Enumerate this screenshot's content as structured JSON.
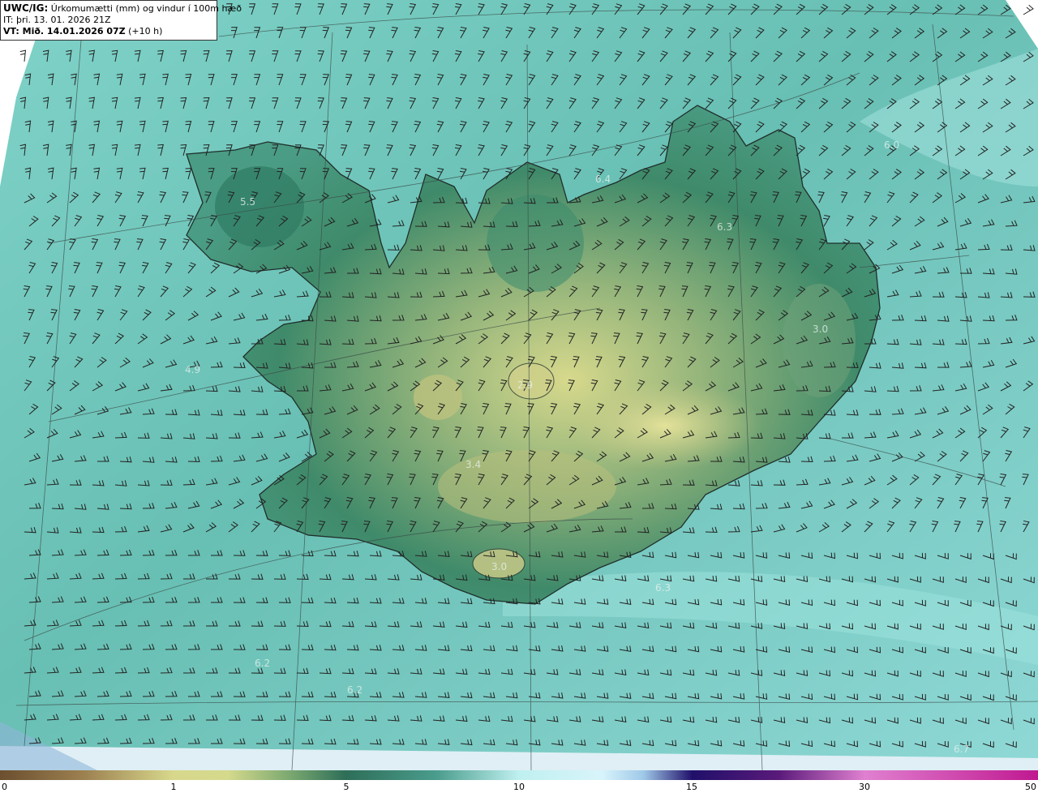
{
  "header": {
    "model": "UWC/IG:",
    "title": "Úrkomumætti (mm) og vindur í 100m hæð",
    "initial_time": "IT: þri. 13. 01. 2026 21Z",
    "valid_prefix": "VT: Mið. 14.01.2026 07Z",
    "valid_suffix": "(+10 h)"
  },
  "map_values": [
    "5.5",
    "6.3",
    "3.0",
    "4.9",
    "2.9",
    "3.4",
    "3.0",
    "6.2",
    "6.2",
    "6.7",
    "6.0",
    "6.4",
    "6.3"
  ],
  "colorbar": {
    "ticks": [
      "0",
      "1",
      "5",
      "10",
      "15",
      "30",
      "50"
    ],
    "colors": [
      "#6b4f2f",
      "#b09050",
      "#d9d98a",
      "#7aa870",
      "#2e6e58",
      "#5cb5a8",
      "#bff0f0",
      "#d8f4fb",
      "#4060c8",
      "#20106a",
      "#7a2080",
      "#e080d0",
      "#c01890"
    ]
  }
}
